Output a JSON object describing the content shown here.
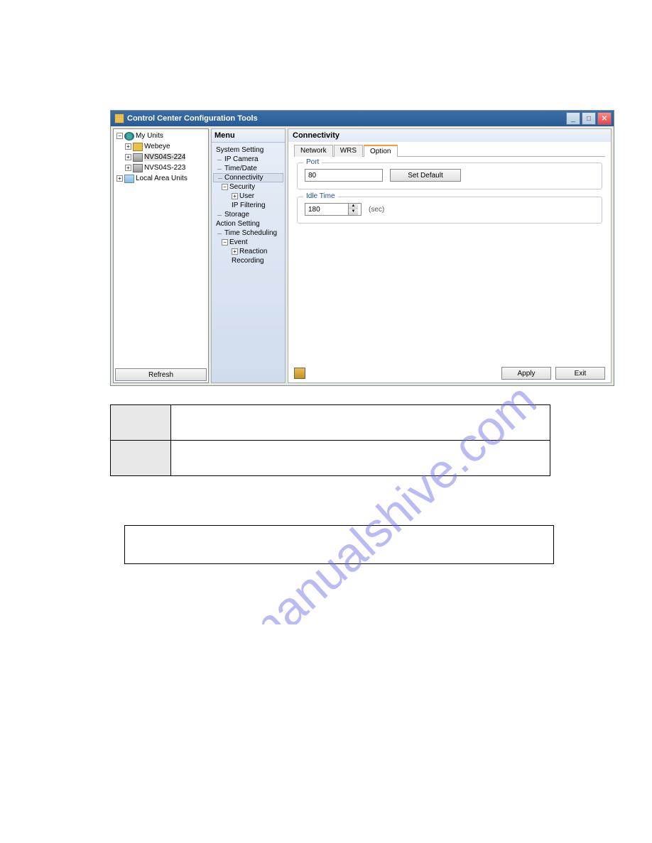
{
  "window": {
    "title": "Control Center Configuration Tools"
  },
  "tree": {
    "root1": "My Units",
    "webeye": "Webeye",
    "nvs224": "NVS04S-224",
    "nvs223": "NVS04S-223",
    "root2": "Local Area Units",
    "refresh": "Refresh"
  },
  "menu": {
    "header": "Menu",
    "system_setting": "System Setting",
    "ip_camera": "IP Camera",
    "time_date": "Time/Date",
    "connectivity": "Connectivity",
    "security": "Security",
    "user": "User",
    "ip_filtering": "IP Filtering",
    "storage": "Storage",
    "action_setting": "Action Setting",
    "time_scheduling": "Time Scheduling",
    "event": "Event",
    "reaction": "Reaction",
    "recording": "Recording"
  },
  "content": {
    "header": "Connectivity",
    "tabs": {
      "network": "Network",
      "wrs": "WRS",
      "option": "Option"
    },
    "port": {
      "legend": "Port",
      "value": "80",
      "set_default": "Set Default"
    },
    "idle_time": {
      "legend": "Idle Time",
      "value": "180",
      "unit": "(sec)"
    },
    "footer": {
      "apply": "Apply",
      "exit": "Exit"
    }
  },
  "expanders": {
    "minus": "−",
    "plus": "+"
  },
  "watermark": "manualshive.com"
}
